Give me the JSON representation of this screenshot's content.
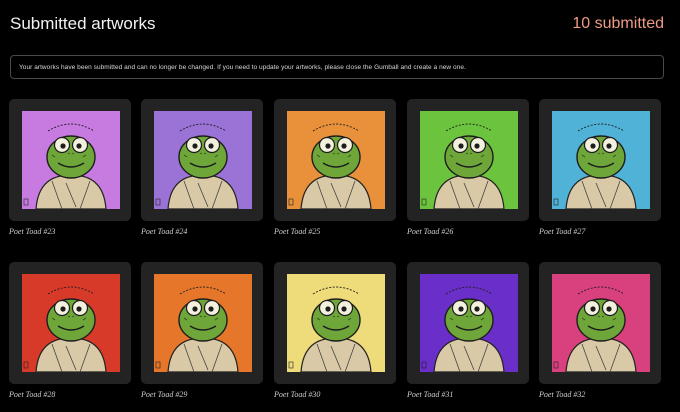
{
  "header": {
    "title": "Submitted artworks",
    "count_text": "10 submitted",
    "accent_color": "#f09a84"
  },
  "notice": {
    "text": "Your artworks have been submitted and can no longer be changed. If you need to update your artworks, please close the Gumball and create a new one."
  },
  "artworks": [
    {
      "name": "Poet Toad #23",
      "bg": "#c77be0"
    },
    {
      "name": "Poet Toad #24",
      "bg": "#9b72d6"
    },
    {
      "name": "Poet Toad #25",
      "bg": "#e8913a"
    },
    {
      "name": "Poet Toad #26",
      "bg": "#6cc43e"
    },
    {
      "name": "Poet Toad #27",
      "bg": "#4fb2d6"
    },
    {
      "name": "Poet Toad #28",
      "bg": "#d83a2a"
    },
    {
      "name": "Poet Toad #29",
      "bg": "#e5762a"
    },
    {
      "name": "Poet Toad #30",
      "bg": "#eedb7a"
    },
    {
      "name": "Poet Toad #31",
      "bg": "#6a2fc8"
    },
    {
      "name": "Poet Toad #32",
      "bg": "#d8407e"
    }
  ]
}
